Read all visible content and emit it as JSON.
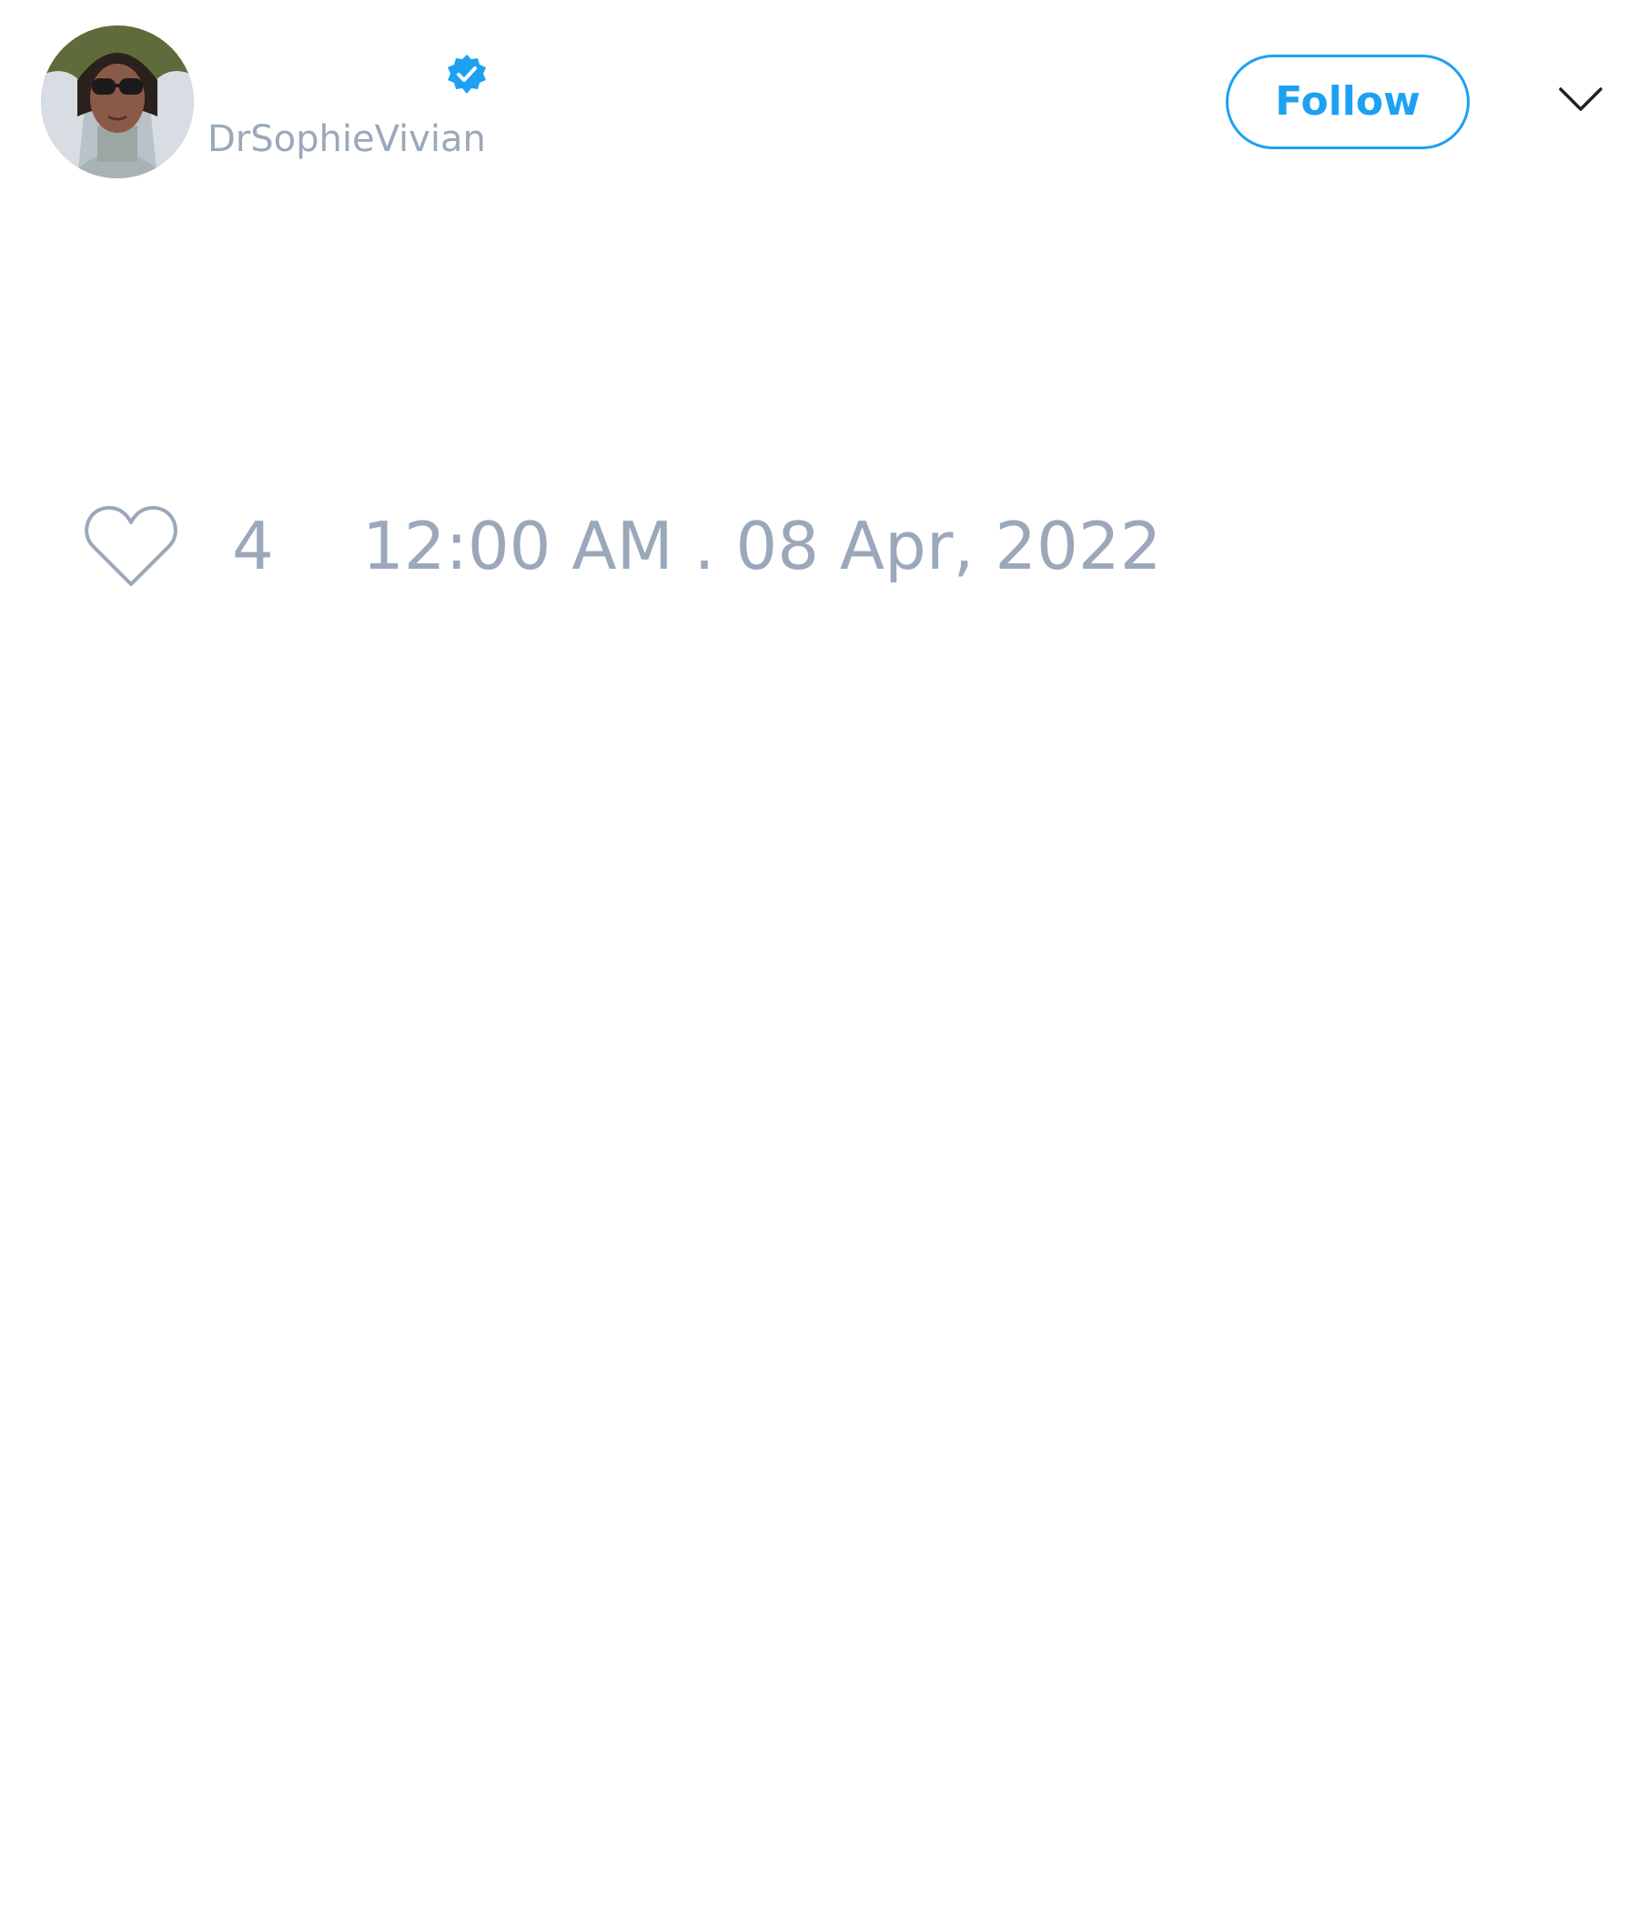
{
  "tweet": {
    "author": {
      "handle": "DrSophieVivian",
      "verified": true,
      "verified_color": "#1da1f2",
      "avatar_icon": "profile-photo"
    },
    "follow_label": "Follow",
    "menu_icon": "chevron-down-icon",
    "like_icon": "heart-outline-icon",
    "like_count": "4",
    "timestamp": "12:00 AM . 08 Apr, 2022"
  },
  "colors": {
    "accent": "#1da1f2",
    "muted_text": "#9aa8ba",
    "background": "#ffffff"
  }
}
